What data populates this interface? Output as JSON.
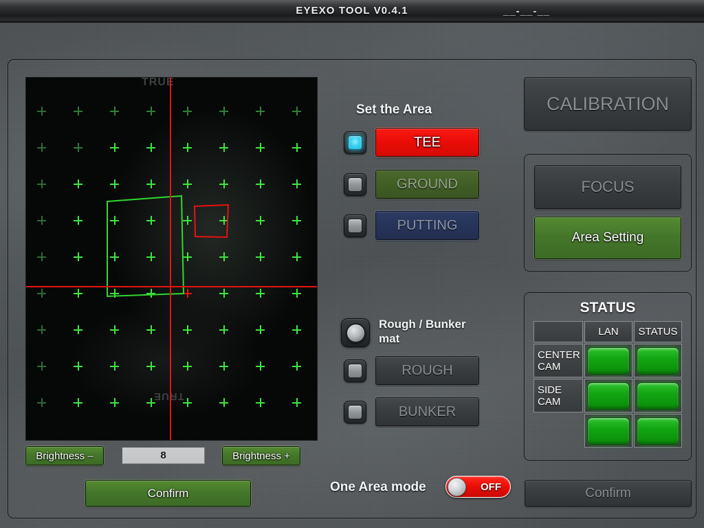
{
  "titlebar": {
    "title": "EYEXO TOOL V0.4.1",
    "right_text": "__-__-__"
  },
  "camera": {
    "watermark_top": "TRUE",
    "watermark_bottom": "TRUE",
    "crosshair_color": "#e8120f",
    "marker_color": "#3ee63e",
    "ground_polygon_color": "#33dd33",
    "tee_polygon_color": "#e8120f"
  },
  "brightness": {
    "minus_label": "Brightness –",
    "plus_label": "Brightness +",
    "value": "8"
  },
  "left_confirm": {
    "label": "Confirm"
  },
  "area": {
    "heading": "Set the Area",
    "items": [
      {
        "label": "TEE",
        "checked": true,
        "style": "red"
      },
      {
        "label": "GROUND",
        "checked": false,
        "style": "olive"
      },
      {
        "label": "PUTTING",
        "checked": false,
        "style": "navy"
      }
    ]
  },
  "mat": {
    "heading": "Rough / Bunker mat",
    "items": [
      {
        "label": "ROUGH",
        "checked": false
      },
      {
        "label": "BUNKER",
        "checked": false
      }
    ]
  },
  "one_area_mode": {
    "label": "One Area mode",
    "state": "OFF",
    "on_color": "#22b422",
    "off_color": "#ea0d07"
  },
  "right_panel": {
    "calibration_label": "CALIBRATION",
    "focus_label": "FOCUS",
    "area_setting_label": "Area Setting",
    "confirm_label": "Confirm"
  },
  "status": {
    "title": "STATUS",
    "columns": [
      "",
      "LAN",
      "STATUS"
    ],
    "rows": [
      {
        "label": "CENTER\nCAM",
        "lan": "ok",
        "status": "ok"
      },
      {
        "label": "SIDE\nCAM",
        "lan": "ok",
        "status": "ok"
      },
      {
        "label": "",
        "lan": "ok",
        "status": "ok"
      }
    ],
    "led_color": "#12a512"
  }
}
